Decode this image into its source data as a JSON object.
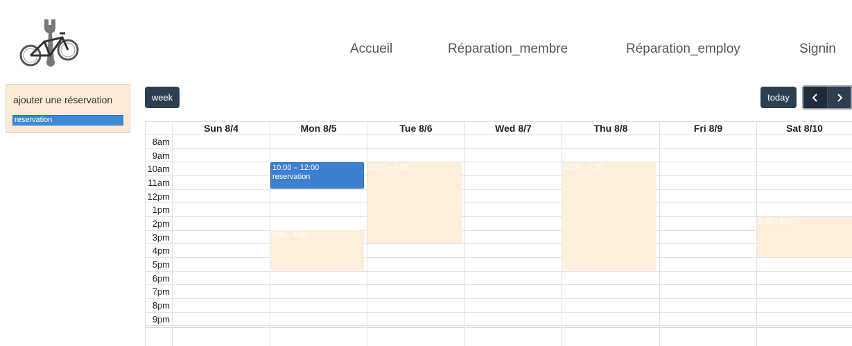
{
  "nav": {
    "items": [
      {
        "label": "Accueil"
      },
      {
        "label": "Réparation_membre"
      },
      {
        "label": "Réparation_employ"
      },
      {
        "label": "Signin"
      }
    ]
  },
  "sidebar": {
    "title": "ajouter une réservation",
    "draggable_event": "reservation"
  },
  "toolbar": {
    "view_label": "week",
    "today_label": "today",
    "prev_icon": "chevron-left-icon",
    "next_icon": "chevron-right-icon"
  },
  "calendar": {
    "days": [
      {
        "label": "Sun 8/4"
      },
      {
        "label": "Mon 8/5"
      },
      {
        "label": "Tue 8/6"
      },
      {
        "label": "Wed 8/7"
      },
      {
        "label": "Thu 8/8"
      },
      {
        "label": "Fri 8/9"
      },
      {
        "label": "Sat 8/10"
      }
    ],
    "times": [
      "8am",
      "9am",
      "10am",
      "11am",
      "12pm",
      "1pm",
      "2pm",
      "3pm",
      "4pm",
      "5pm",
      "6pm",
      "7pm",
      "8pm",
      "9pm"
    ],
    "events": [
      {
        "day": "Mon 8/5",
        "time": "10:00 – 12:00",
        "title": "reservation"
      }
    ],
    "availability": [
      {
        "day": "Mon 8/5",
        "time": "3:00 – 6:00"
      },
      {
        "day": "Tue 8/6",
        "time": "10:00 – 4:00"
      },
      {
        "day": "Thu 8/8",
        "time": "10:00 – 6:00"
      },
      {
        "day": "Sat 8/10",
        "time": "2:00 – 5:00"
      }
    ]
  },
  "colors": {
    "primary_button": "#2c3e50",
    "event": "#3c80d3",
    "availability": "#fdefdc",
    "sidebar_bg": "#fcecd7"
  }
}
